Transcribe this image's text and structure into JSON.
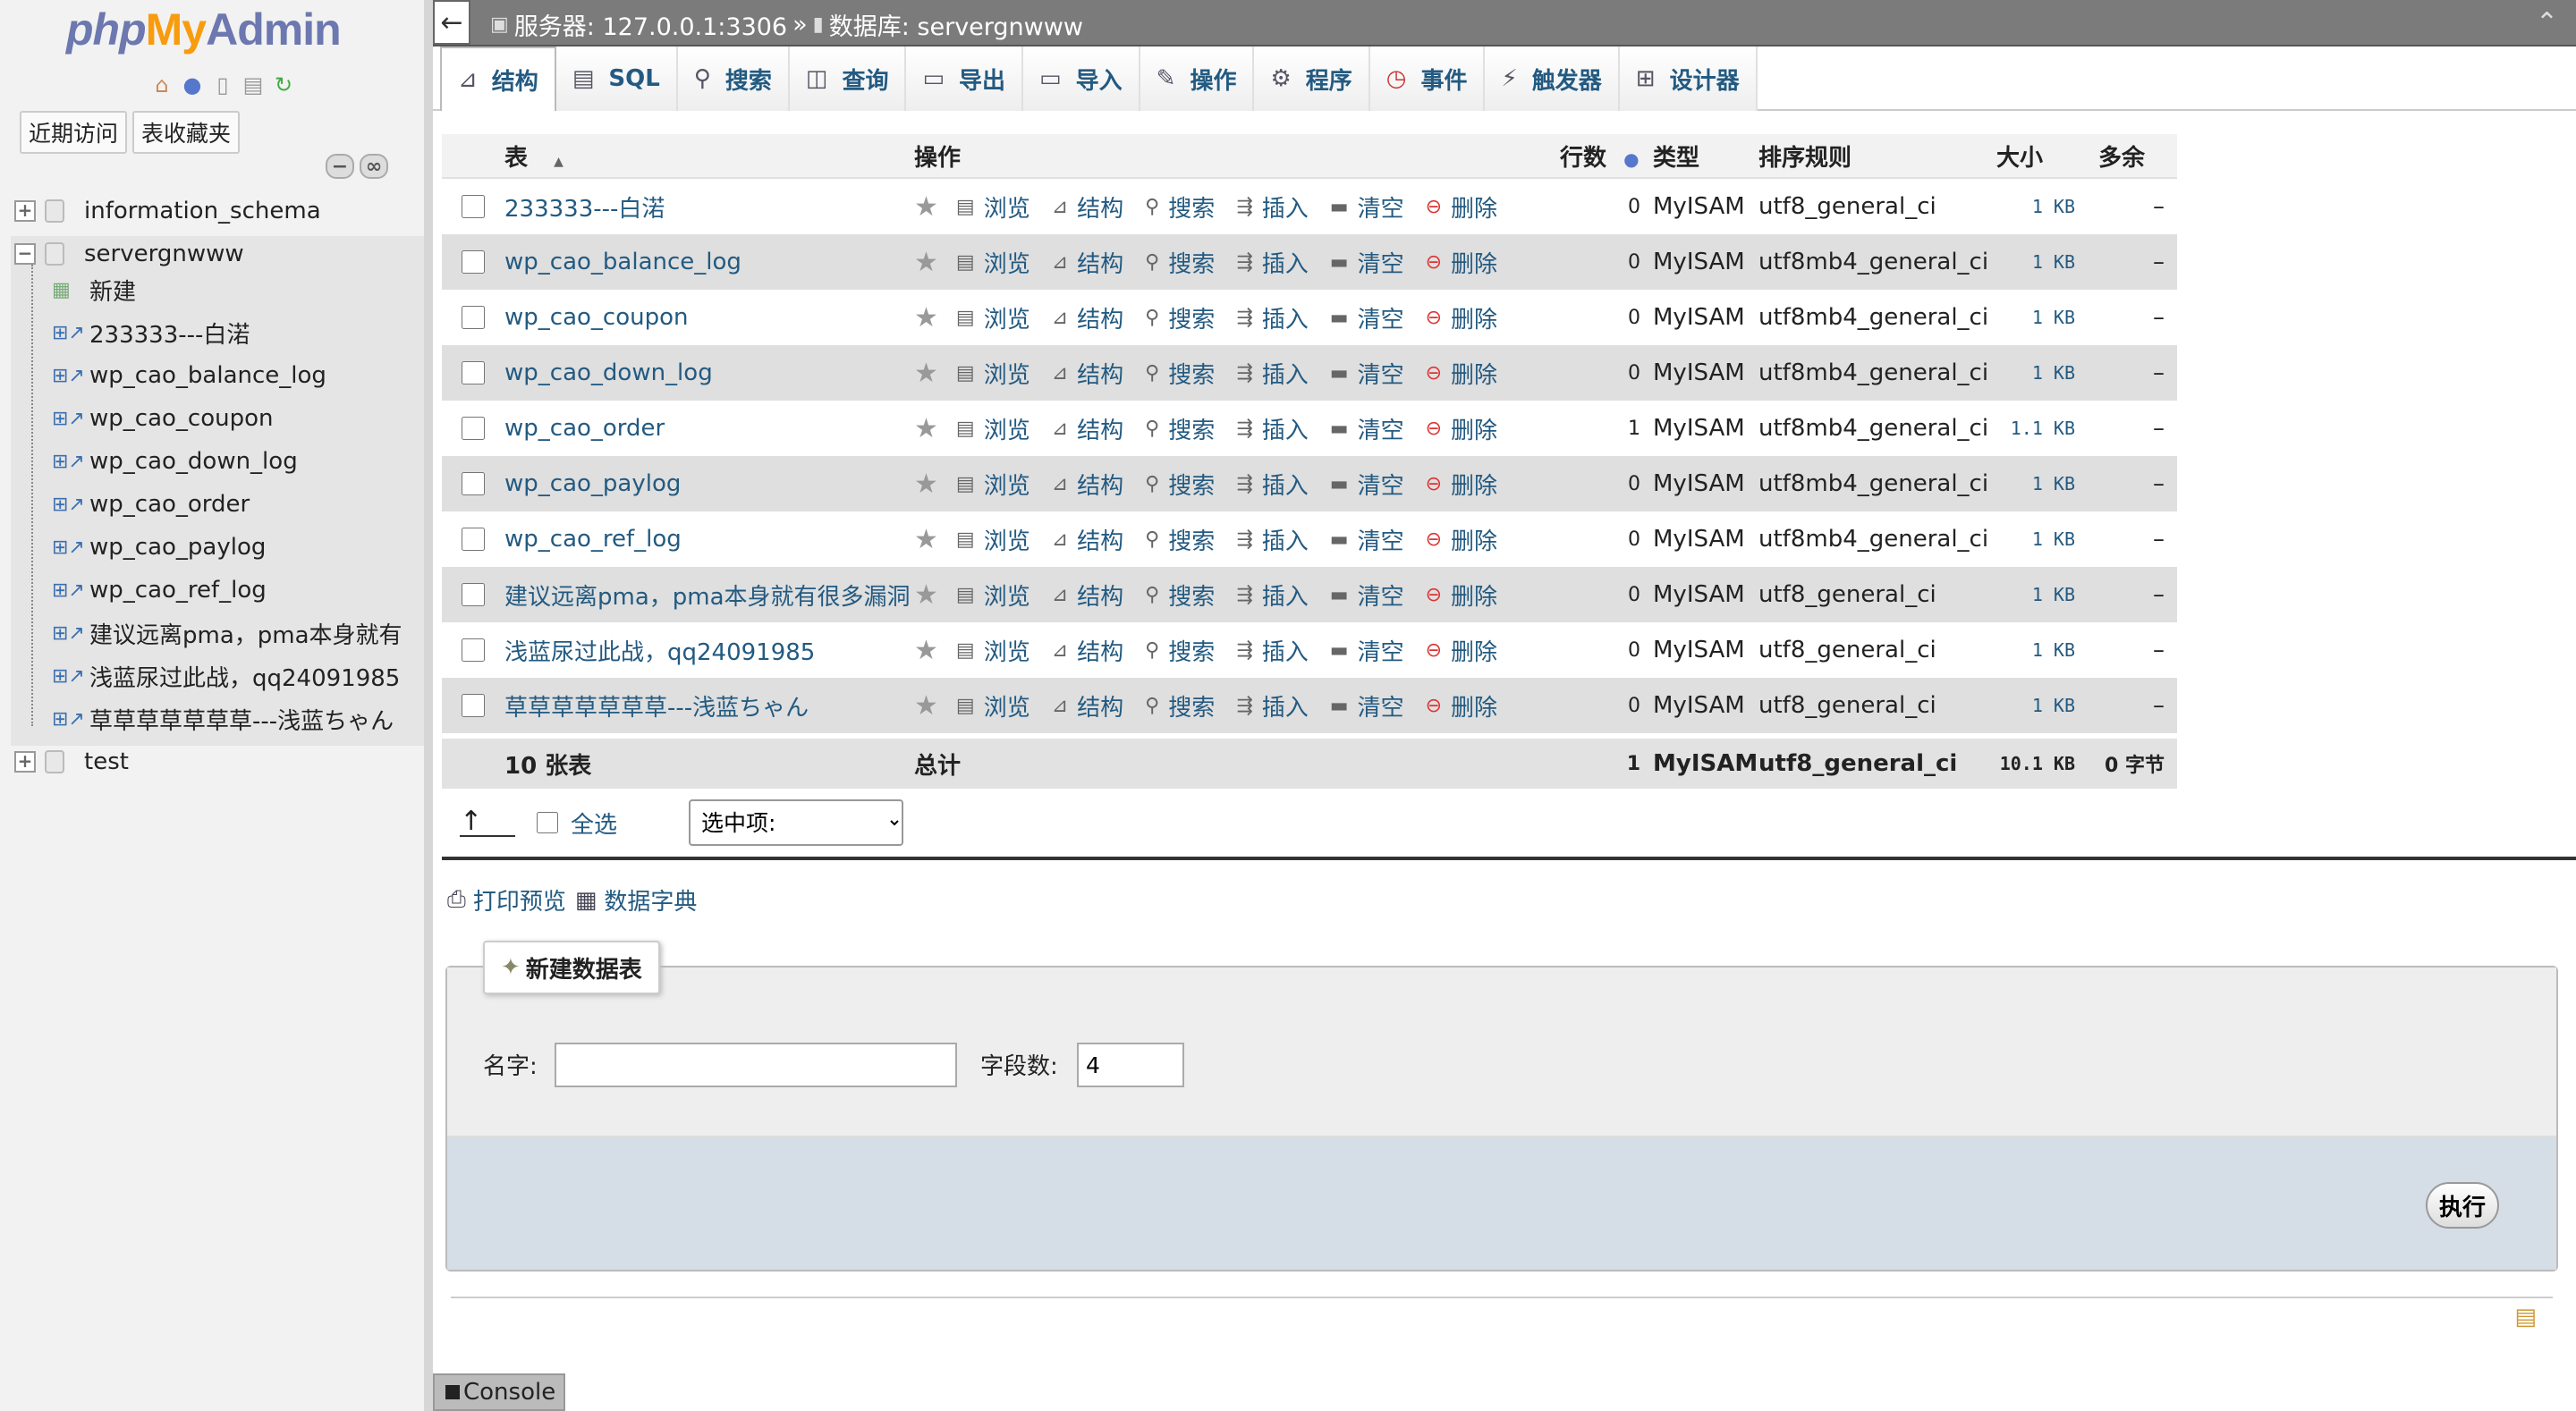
{
  "logo": {
    "php": "php",
    "my": "My",
    "admin": "Admin"
  },
  "nav": {
    "tabs": [
      "近期访问",
      "表收藏夹"
    ],
    "databases": [
      "information_schema",
      "servergnwww",
      "test"
    ],
    "new_label": "新建",
    "tables": [
      "233333---白渃",
      "wp_cao_balance_log",
      "wp_cao_coupon",
      "wp_cao_down_log",
      "wp_cao_order",
      "wp_cao_paylog",
      "wp_cao_ref_log",
      "建议远离pma，pma本身就有",
      "浅蓝尿过此战，qq24091985",
      "草草草草草草草---浅蓝ちゃん"
    ]
  },
  "breadcrumb": {
    "server": "服务器: 127.0.0.1:3306",
    "sep": "»",
    "database": "数据库: servergnwww"
  },
  "tabs": [
    "结构",
    "SQL",
    "搜索",
    "查询",
    "导出",
    "导入",
    "操作",
    "程序",
    "事件",
    "触发器",
    "设计器"
  ],
  "table_list": {
    "headers": {
      "table": "表",
      "sort_indicator": "▲",
      "action": "操作",
      "rows": "行数",
      "type": "类型",
      "collation": "排序规则",
      "size": "大小",
      "overhead": "多余"
    },
    "ops": [
      "浏览",
      "结构",
      "搜索",
      "插入",
      "清空",
      "删除"
    ],
    "rows": [
      {
        "name": "233333---白渃",
        "rows": "0",
        "type": "MyISAM",
        "collation": "utf8_general_ci",
        "size": "1 KB",
        "overhead": "–"
      },
      {
        "name": "wp_cao_balance_log",
        "rows": "0",
        "type": "MyISAM",
        "collation": "utf8mb4_general_ci",
        "size": "1 KB",
        "overhead": "–"
      },
      {
        "name": "wp_cao_coupon",
        "rows": "0",
        "type": "MyISAM",
        "collation": "utf8mb4_general_ci",
        "size": "1 KB",
        "overhead": "–"
      },
      {
        "name": "wp_cao_down_log",
        "rows": "0",
        "type": "MyISAM",
        "collation": "utf8mb4_general_ci",
        "size": "1 KB",
        "overhead": "–"
      },
      {
        "name": "wp_cao_order",
        "rows": "1",
        "type": "MyISAM",
        "collation": "utf8mb4_general_ci",
        "size": "1.1 KB",
        "overhead": "–"
      },
      {
        "name": "wp_cao_paylog",
        "rows": "0",
        "type": "MyISAM",
        "collation": "utf8mb4_general_ci",
        "size": "1 KB",
        "overhead": "–"
      },
      {
        "name": "wp_cao_ref_log",
        "rows": "0",
        "type": "MyISAM",
        "collation": "utf8mb4_general_ci",
        "size": "1 KB",
        "overhead": "–"
      },
      {
        "name": "建议远离pma，pma本身就有很多漏洞",
        "rows": "0",
        "type": "MyISAM",
        "collation": "utf8_general_ci",
        "size": "1 KB",
        "overhead": "–"
      },
      {
        "name": "浅蓝尿过此战，qq24091985",
        "rows": "0",
        "type": "MyISAM",
        "collation": "utf8_general_ci",
        "size": "1 KB",
        "overhead": "–"
      },
      {
        "name": "草草草草草草草---浅蓝ちゃん",
        "rows": "0",
        "type": "MyISAM",
        "collation": "utf8_general_ci",
        "size": "1 KB",
        "overhead": "–"
      }
    ],
    "footer": {
      "count": "10 张表",
      "total": "总计",
      "rows": "1",
      "type": "MyISAM",
      "collation": "utf8_general_ci",
      "size": "10.1 KB",
      "overhead": "0 字节"
    }
  },
  "bulk": {
    "check_all": "全选",
    "with_selected": "选中项:"
  },
  "links": {
    "print": "打印预览",
    "dictionary": "数据字典"
  },
  "create_table": {
    "legend": "新建数据表",
    "name_label": "名字:",
    "name_value": "",
    "cols_label": "字段数:",
    "cols_value": "4",
    "go": "执行"
  },
  "console": "Console"
}
